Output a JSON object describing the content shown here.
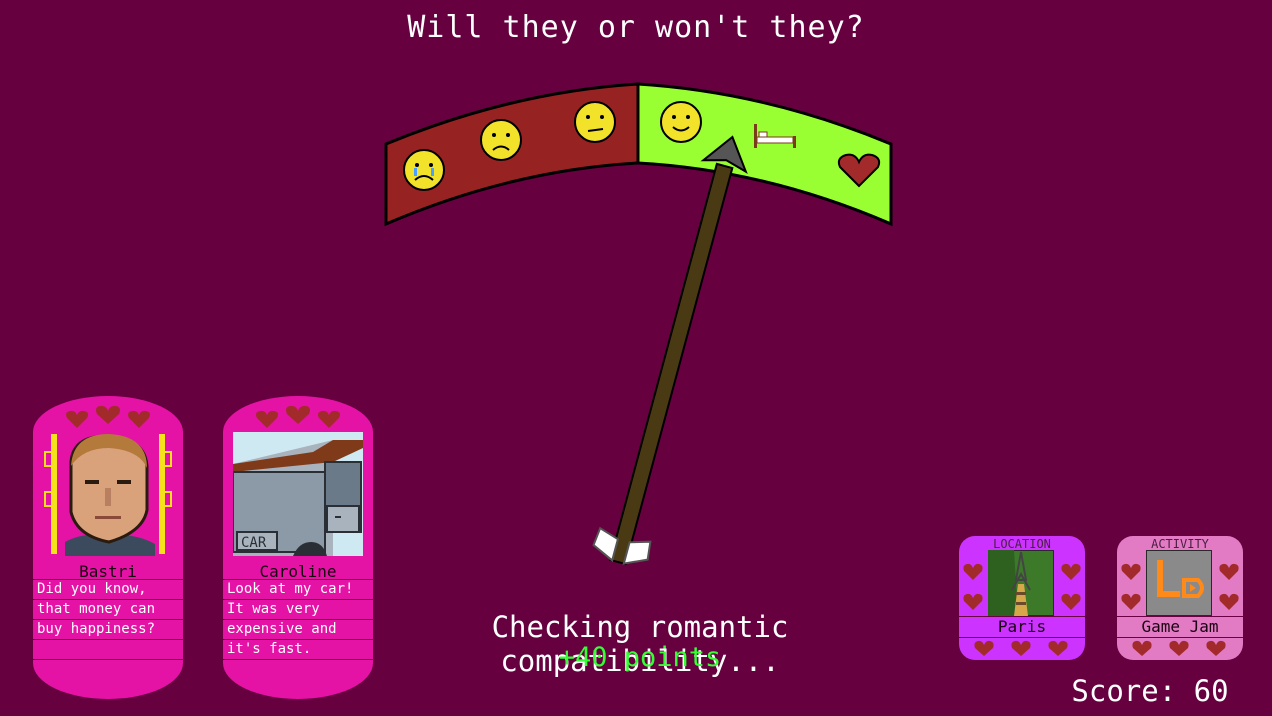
{
  "title": "Will they or won't they?",
  "status_text": "Checking romantic compatibility...",
  "points_text": "+40 points",
  "score_text": "Score: 60",
  "meter": {
    "arrow_value": 0.72,
    "negative_color": "#962222",
    "positive_color": "#99ff33",
    "icons": [
      "crying-face-icon",
      "sad-face-icon",
      "neutral-face-icon",
      "smile-face-icon",
      "bed-icon",
      "heart-icon"
    ]
  },
  "characters": [
    {
      "name": "Bastri",
      "dialogue": [
        "Did you know,",
        "that money can",
        "buy happiness?",
        ""
      ]
    },
    {
      "name": "Caroline",
      "dialogue": [
        "Look at my car!",
        "It was very",
        "expensive and",
        "it's fast."
      ]
    }
  ],
  "location": {
    "caption": "LOCATION",
    "name": "Paris",
    "color": "#cc33ff"
  },
  "activity": {
    "caption": "ACTIVITY",
    "name": "Game Jam",
    "color": "#e27ac4"
  },
  "colors": {
    "background": "#66003f",
    "card_pink": "#e512a6",
    "heart": "#a32a2a",
    "points_green": "#33ff33"
  }
}
